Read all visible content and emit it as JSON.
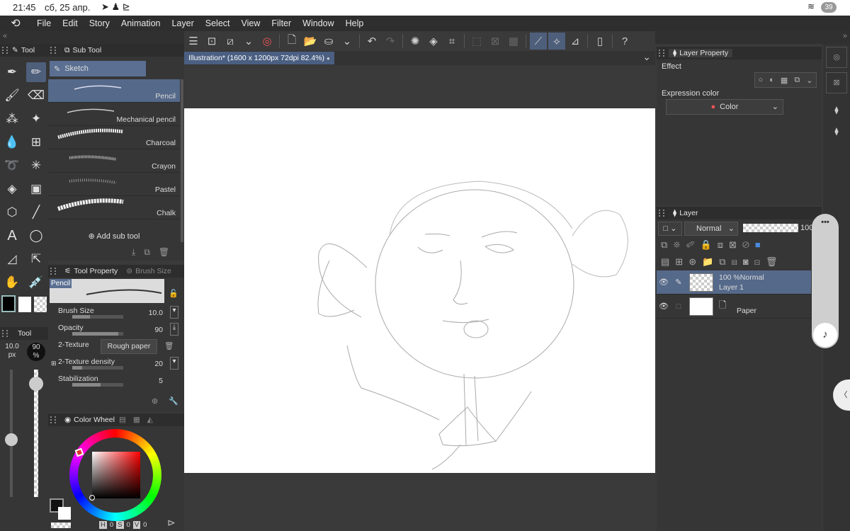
{
  "status": {
    "time": "21:45",
    "date": "сб, 25 апр.",
    "battery": "39"
  },
  "menu": [
    "File",
    "Edit",
    "Story",
    "Animation",
    "Layer",
    "Select",
    "View",
    "Filter",
    "Window",
    "Help"
  ],
  "tool_panel": {
    "title": "Tool"
  },
  "sub_tool": {
    "title": "Sub Tool",
    "group": "Sketch",
    "brushes": [
      "Pencil",
      "Mechanical pencil",
      "Charcoal",
      "Crayon",
      "Pastel",
      "Chalk"
    ],
    "add_label": "Add sub tool"
  },
  "tool_property": {
    "title": "Tool Property",
    "tab2": "Brush Size",
    "preview_label": "Pencil",
    "brush_size": {
      "label": "Brush Size",
      "value": "10.0",
      "fraction": 0.35
    },
    "opacity": {
      "label": "Opacity",
      "value": "90",
      "fraction": 0.9
    },
    "texture": {
      "label": "2-Texture",
      "value": "Rough paper"
    },
    "texture_density": {
      "label": "2-Texture density",
      "value": "20",
      "fraction": 0.2
    },
    "stabilization": {
      "label": "Stabilization",
      "value": "5",
      "fraction": 0.55
    }
  },
  "tool_slider": {
    "title": "Tool",
    "size_value": "10.0",
    "size_unit": "px",
    "opacity_value": "90",
    "opacity_unit": "%"
  },
  "color_wheel": {
    "title": "Color Wheel",
    "h_label": "H",
    "h": "0",
    "s_label": "S",
    "s": "0",
    "v_label": "V",
    "v": "0"
  },
  "canvas": {
    "tab_title": "Illustration* (1600 x 1200px 72dpi 82.4%)"
  },
  "layer_property": {
    "title": "Layer Property",
    "effect_label": "Effect",
    "expression_label": "Expression color",
    "expression_value": "Color"
  },
  "layer_panel": {
    "title": "Layer",
    "blend": "Normal",
    "opacity": "100",
    "layers": [
      {
        "opacity": "100 %",
        "blend": "Normal",
        "name": "Layer 1"
      },
      {
        "name": "Paper"
      }
    ]
  },
  "colors": {
    "accent": "#4e5f7c",
    "selected_row": "#55698a",
    "canvas": "#ffffff"
  }
}
